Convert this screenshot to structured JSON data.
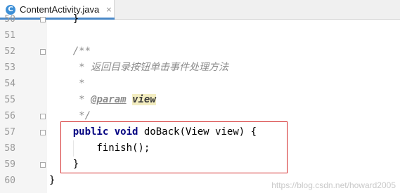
{
  "tab": {
    "icon_letter": "C",
    "title": "ContentActivity.java",
    "close_glyph": "×"
  },
  "line_numbers": [
    "50",
    "51",
    "52",
    "53",
    "54",
    "55",
    "56",
    "57",
    "58",
    "59",
    "60"
  ],
  "code": {
    "l50": "    }",
    "l51": "",
    "l52": "    /**",
    "l53_prefix": "     * ",
    "l53_text": "返回目录按钮单击事件处理方法",
    "l54": "     *",
    "l55_prefix": "     * ",
    "l55_tag": "@param",
    "l55_sp": " ",
    "l55_param": "view",
    "l56": "     */",
    "l57_indent": "    ",
    "l57_kw1": "public",
    "l57_sp": " ",
    "l57_kw2": "void",
    "l57_rest": " doBack(View view) {",
    "l58": "        finish();",
    "l59": "    }",
    "l60": "}"
  },
  "watermark": "https://blog.csdn.net/howard2005",
  "colors": {
    "keyword": "#000080",
    "comment": "#8c8c8c",
    "param_highlight": "#f3edc0",
    "highlight_box": "#d32a2a",
    "tab_icon": "#3d8fd6"
  }
}
